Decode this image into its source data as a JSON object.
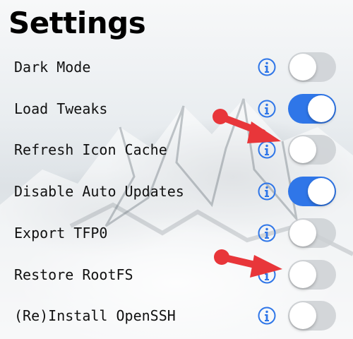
{
  "page": {
    "title": "Settings"
  },
  "settings": [
    {
      "label": "Dark Mode",
      "on": false
    },
    {
      "label": "Load Tweaks",
      "on": true
    },
    {
      "label": "Refresh Icon Cache",
      "on": false
    },
    {
      "label": "Disable Auto Updates",
      "on": true
    },
    {
      "label": "Export TFP0",
      "on": false
    },
    {
      "label": "Restore RootFS",
      "on": false
    },
    {
      "label": "(Re)Install OpenSSH",
      "on": false
    }
  ],
  "colors": {
    "accent": "#2f76e8",
    "info_icon": "#2f76e8",
    "annotation_arrow": "#e8363a",
    "toggle_off": "#cdd0d4"
  },
  "icons": {
    "info": "info-circle-icon",
    "annotation": "arrow-annotation-icon"
  }
}
